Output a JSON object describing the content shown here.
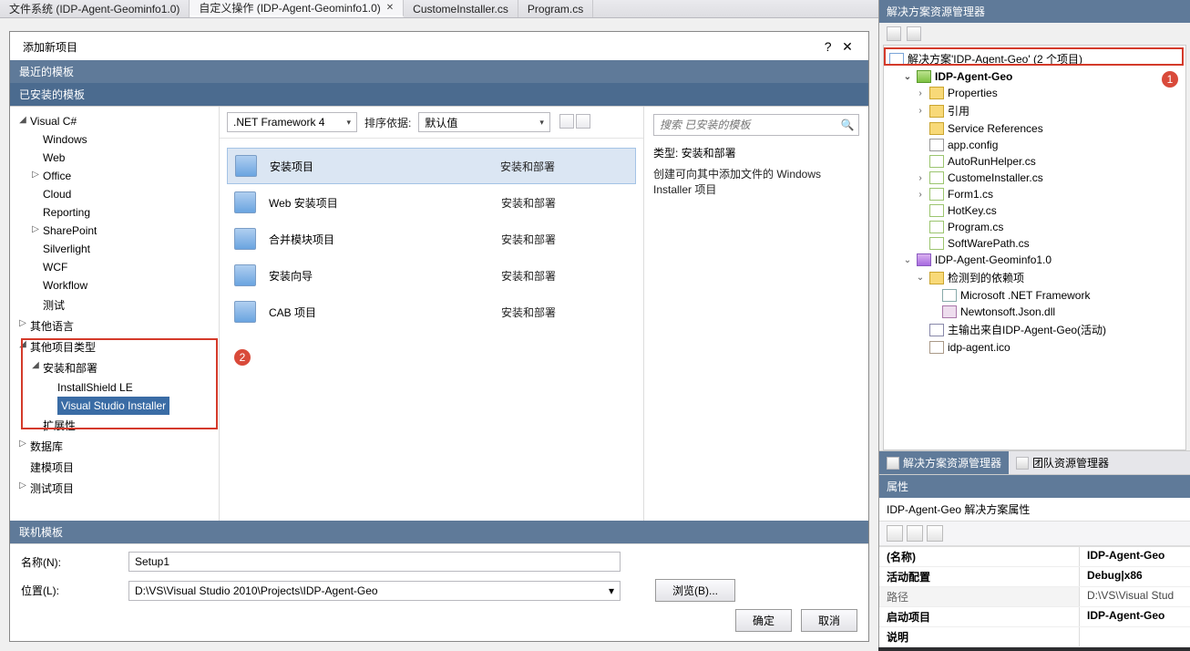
{
  "tabs": {
    "filesystem": "文件系统 (IDP-Agent-Geominfo1.0)",
    "custom_ops": "自定义操作 (IDP-Agent-Geominfo1.0)",
    "custome_installer": "CustomeInstaller.cs",
    "program": "Program.cs"
  },
  "dialog": {
    "title": "添加新项目",
    "recent": "最近的模板",
    "installed": "已安装的模板",
    "online": "联机模板",
    "tree": {
      "csharp": "Visual C#",
      "windows": "Windows",
      "web": "Web",
      "office": "Office",
      "cloud": "Cloud",
      "reporting": "Reporting",
      "sharepoint": "SharePoint",
      "silverlight": "Silverlight",
      "wcf": "WCF",
      "workflow": "Workflow",
      "test": "测试",
      "other_lang": "其他语言",
      "other_proj": "其他项目类型",
      "setup_deploy": "安装和部署",
      "installshield": "InstallShield LE",
      "vs_installer": "Visual Studio Installer",
      "extensibility": "扩展性",
      "database": "数据库",
      "modeling": "建模项目",
      "test_proj": "测试项目"
    },
    "framework": ".NET Framework 4",
    "sort_label": "排序依据:",
    "sort_value": "默认值",
    "search_ph": "搜索 已安装的模板",
    "templates": [
      {
        "name": "安装项目",
        "cat": "安装和部署"
      },
      {
        "name": "Web 安装项目",
        "cat": "安装和部署"
      },
      {
        "name": "合并模块项目",
        "cat": "安装和部署"
      },
      {
        "name": "安装向导",
        "cat": "安装和部署"
      },
      {
        "name": "CAB 项目",
        "cat": "安装和部署"
      }
    ],
    "desc_title": "类型: 安装和部署",
    "desc_text": "创建可向其中添加文件的 Windows Installer 项目",
    "name_label": "名称(N):",
    "name_value": "Setup1",
    "loc_label": "位置(L):",
    "loc_value": "D:\\VS\\Visual Studio 2010\\Projects\\IDP-Agent-Geo",
    "browse": "浏览(B)...",
    "ok": "确定",
    "cancel": "取消"
  },
  "annot": {
    "one": "1",
    "two": "2"
  },
  "solution": {
    "header": "解决方案资源管理器",
    "root": "解决方案'IDP-Agent-Geo' (2 个项目)",
    "proj1": "IDP-Agent-Geo",
    "properties": "Properties",
    "references": "引用",
    "svc_ref": "Service References",
    "app_config": "app.config",
    "autorun": "AutoRunHelper.cs",
    "custome": "CustomeInstaller.cs",
    "form1": "Form1.cs",
    "hotkey": "HotKey.cs",
    "program": "Program.cs",
    "softpath": "SoftWarePath.cs",
    "proj2": "IDP-Agent-Geominfo1.0",
    "detected_deps": "检测到的依赖项",
    "netfx": "Microsoft .NET Framework",
    "newtonsoft": "Newtonsoft.Json.dll",
    "primary_out": "主输出来自IDP-Agent-Geo(活动)",
    "idp_icon": "idp-agent.ico",
    "tab_sol": "解决方案资源管理器",
    "tab_team": "团队资源管理器"
  },
  "props": {
    "header": "属性",
    "sub": "IDP-Agent-Geo 解决方案属性",
    "rows": {
      "name_k": "(名称)",
      "name_v": "IDP-Agent-Geo",
      "cfg_k": "活动配置",
      "cfg_v": "Debug|x86",
      "path_k": "路径",
      "path_v": "D:\\VS\\Visual Stud",
      "start_k": "启动项目",
      "start_v": "IDP-Agent-Geo",
      "desc_k": "说明",
      "desc_v": ""
    }
  }
}
